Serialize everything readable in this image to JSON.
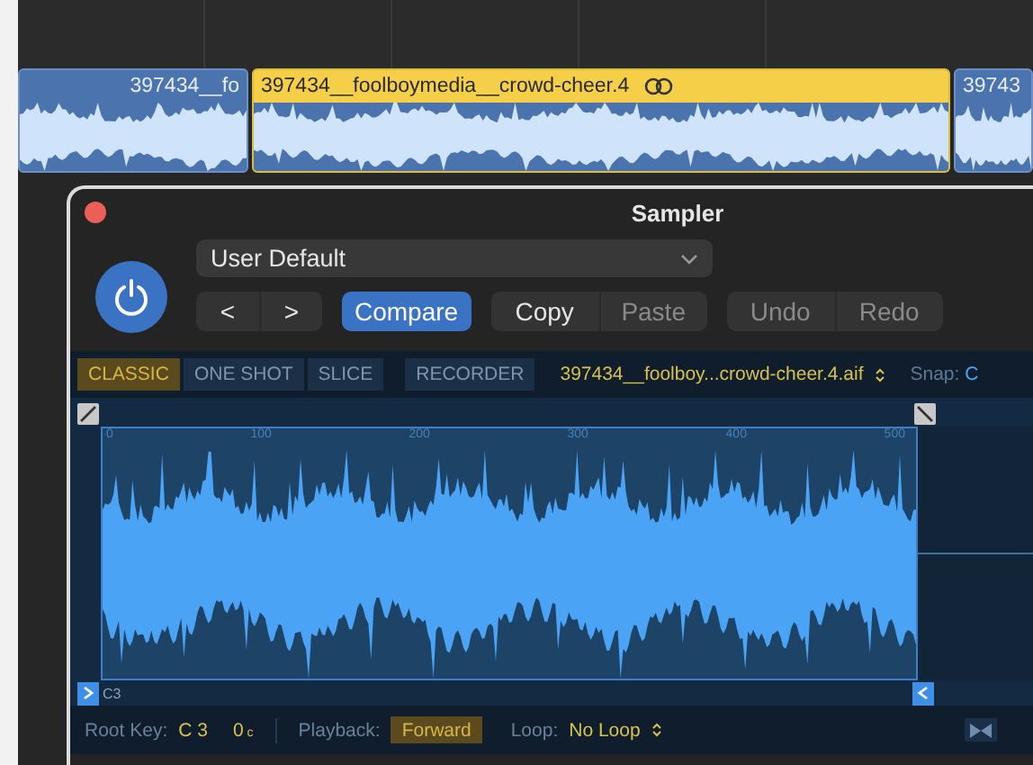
{
  "timeline": {
    "clips": [
      {
        "name": "397434__fo",
        "selected": false,
        "linked": false
      },
      {
        "name": "397434__foolboymedia__crowd-cheer.4",
        "selected": true,
        "linked": true
      },
      {
        "name": "39743",
        "selected": false,
        "linked": false
      }
    ]
  },
  "window": {
    "title": "Sampler"
  },
  "power": {
    "on": true
  },
  "preset": {
    "value": "User Default"
  },
  "nav": [
    "<",
    ">"
  ],
  "compare": {
    "label": "Compare",
    "on": true
  },
  "edit_buttons": [
    {
      "label": "Copy",
      "disabled": false
    },
    {
      "label": "Paste",
      "disabled": true
    }
  ],
  "history_buttons": [
    {
      "label": "Undo",
      "disabled": true
    },
    {
      "label": "Redo",
      "disabled": true
    }
  ],
  "modes": [
    {
      "label": "CLASSIC",
      "selected": true
    },
    {
      "label": "ONE SHOT",
      "selected": false
    },
    {
      "label": "SLICE",
      "selected": false
    }
  ],
  "recorder": {
    "label": "RECORDER"
  },
  "file": "397434__foolboy...crowd-cheer.4.aif",
  "snap": {
    "label": "Snap:",
    "value": "C"
  },
  "ruler": [
    "0",
    "100",
    "200",
    "300",
    "400",
    "500"
  ],
  "root_note": "C3",
  "footer": {
    "root_key_label": "Root Key:",
    "root_key": "C 3",
    "fine": "0",
    "fine_unit": "c",
    "playback_label": "Playback:",
    "playback": "Forward",
    "loop_label": "Loop:",
    "loop": "No Loop"
  }
}
